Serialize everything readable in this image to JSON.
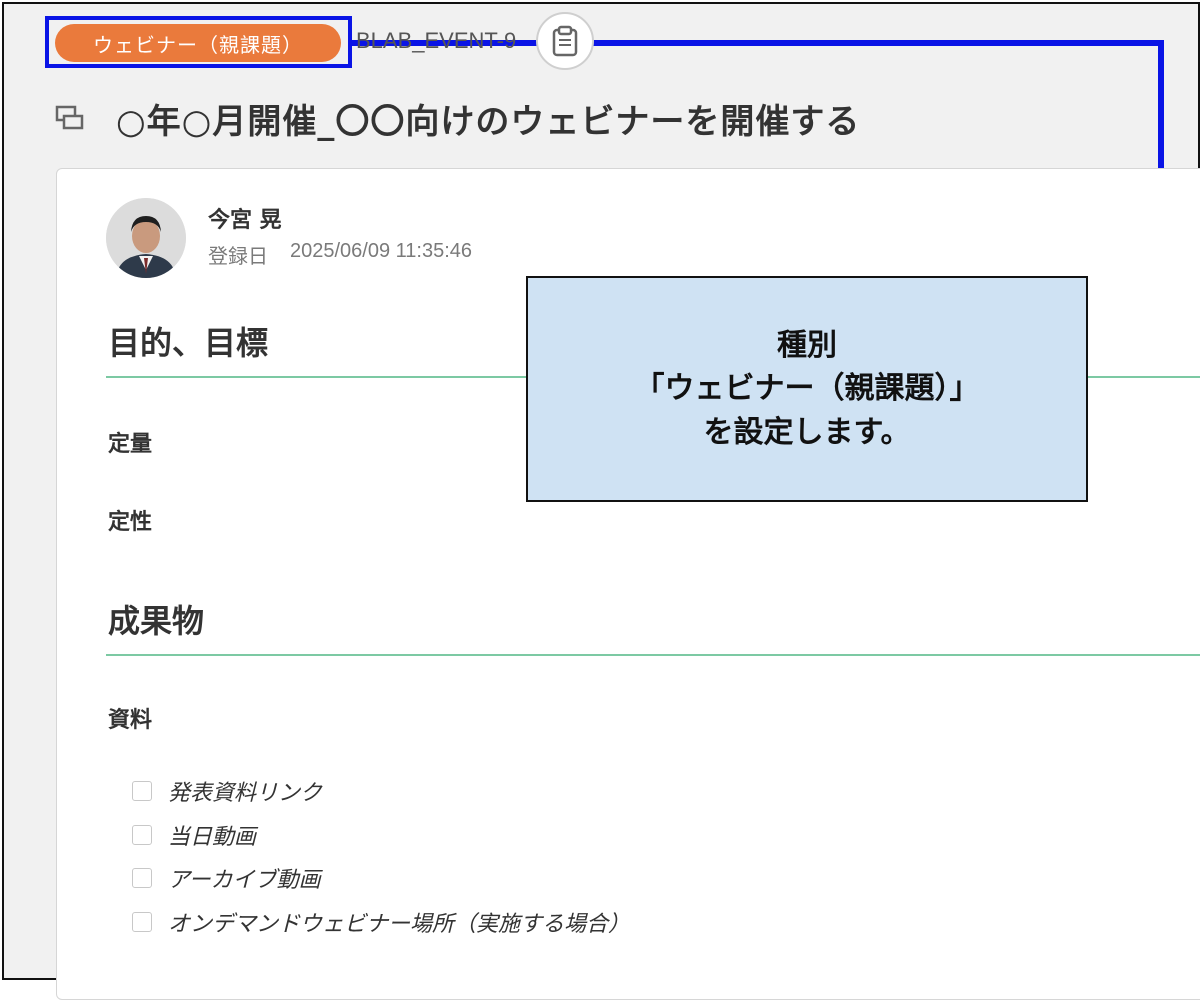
{
  "header": {
    "type_badge": "ウェビナー（親課題）",
    "event_id": "BLAB_EVENT-9",
    "page_title": "○年○月開催_〇〇向けのウェビナーを開催する"
  },
  "author": {
    "name": "今宮 晃",
    "registered_label": "登録日",
    "registered_at": "2025/06/09 11:35:46"
  },
  "sections": {
    "goals_heading": "目的、目標",
    "quantitative": "定量",
    "qualitative": "定性",
    "deliverables_heading": "成果物",
    "materials": "資料"
  },
  "checklist": [
    {
      "label": "発表資料リンク",
      "checked": false
    },
    {
      "label": "当日動画",
      "checked": false
    },
    {
      "label": "アーカイブ動画",
      "checked": false
    },
    {
      "label": "オンデマンドウェビナー場所（実施する場合）",
      "checked": false
    }
  ],
  "callout": {
    "line1": "種別",
    "line2": "「ウェビナー（親課題）」",
    "line3": "を設定します。"
  },
  "colors": {
    "badge": "#ea7a3c",
    "highlight": "#0a14e6",
    "rule": "#7cc9a3",
    "callout_bg": "#cfe2f3"
  },
  "icons": {
    "copy": "clipboard-icon",
    "title": "task-icon"
  }
}
